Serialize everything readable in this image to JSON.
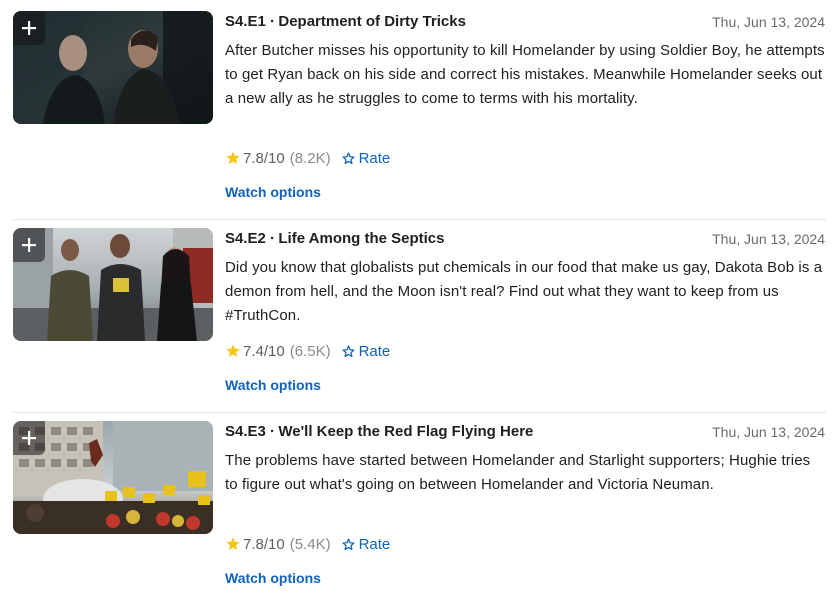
{
  "episodes": [
    {
      "title": "S4.E1 ∙ Department of Dirty Tricks",
      "date": "Thu, Jun 13, 2024",
      "plot": "After Butcher misses his opportunity to kill Homelander by using Soldier Boy, he attempts to get Ryan back on his side and correct his mistakes. Meanwhile Homelander seeks out a new ally as he struggles to come to terms with his mortality.",
      "rating": "7.8",
      "rating_max": "/10",
      "votes": "(8.2K)",
      "rate_label": "Rate",
      "watch_label": "Watch options"
    },
    {
      "title": "S4.E2 ∙ Life Among the Septics",
      "date": "Thu, Jun 13, 2024",
      "plot": "Did you know that globalists put chemicals in our food that make us gay, Dakota Bob is a demon from hell, and the Moon isn't real? Find out what they want to keep from us #TruthCon.",
      "rating": "7.4",
      "rating_max": "/10",
      "votes": "(6.5K)",
      "rate_label": "Rate",
      "watch_label": "Watch options"
    },
    {
      "title": "S4.E3 ∙ We'll Keep the Red Flag Flying Here",
      "date": "Thu, Jun 13, 2024",
      "plot": "The problems have started between Homelander and Starlight supporters; Hughie tries to figure out what's going on between Homelander and Victoria Neuman.",
      "rating": "7.8",
      "rating_max": "/10",
      "votes": "(5.4K)",
      "rate_label": "Rate",
      "watch_label": "Watch options"
    }
  ],
  "icons": {
    "add": "plus-icon",
    "rating_star": "star-filled-icon",
    "rate": "star-outline-icon"
  },
  "colors": {
    "link": "#0e63be",
    "star": "#f5c518",
    "meta": "#6b6b6b"
  }
}
